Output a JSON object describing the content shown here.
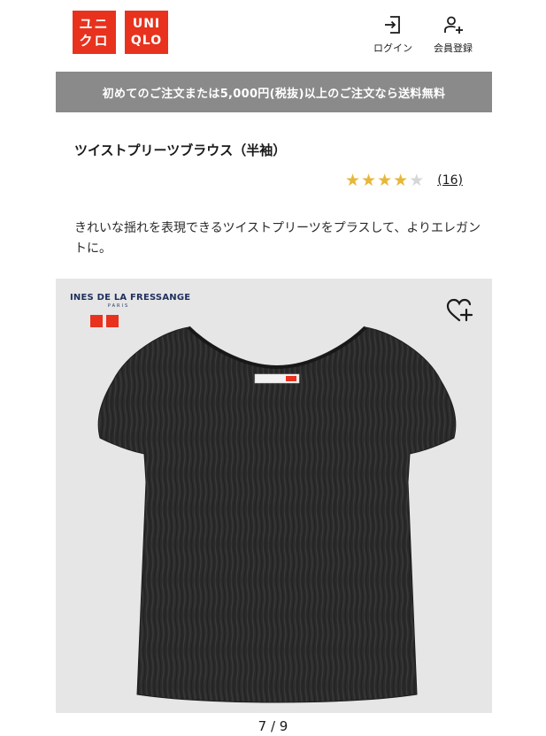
{
  "header": {
    "logo_kana_top": "ユニ",
    "logo_kana_bottom": "クロ",
    "logo_latin_top": "UNI",
    "logo_latin_bottom": "QLO",
    "login_label": "ログイン",
    "register_label": "会員登録",
    "brand_color": "#e8321e"
  },
  "banner": {
    "text": "初めてのご注文または5,000円(税抜)以上のご注文なら送料無料"
  },
  "product": {
    "title": "ツイストプリーツブラウス（半袖）",
    "rating_value": 4,
    "rating_max": 5,
    "review_count": "(16)",
    "description": "きれいな揺れを表現できるツイストプリーツをプラスして、よりエレガントに。"
  },
  "image": {
    "brand_name": "INES DE LA FRESSANGE",
    "brand_city": "PARIS",
    "favorite_icon": "heart-plus-icon"
  },
  "pager": {
    "text": "7 / 9"
  }
}
